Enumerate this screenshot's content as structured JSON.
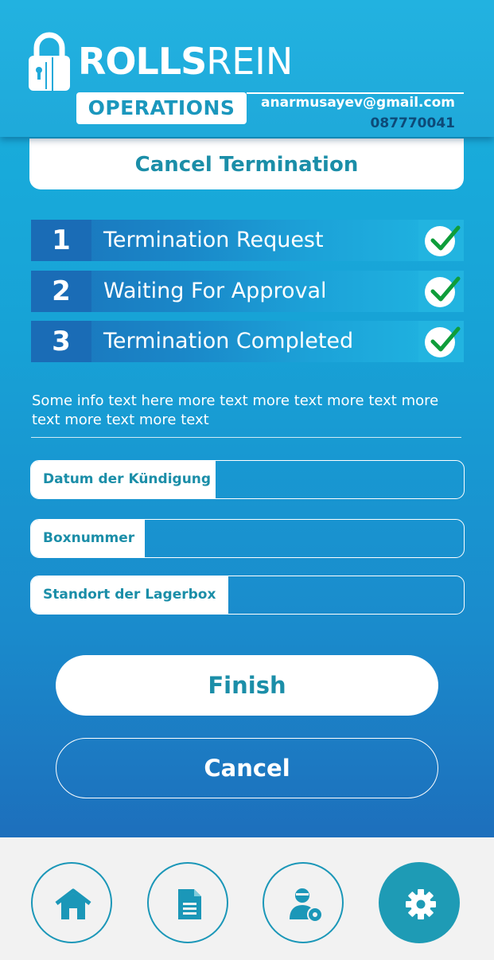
{
  "header": {
    "brand_bold": "ROLLS",
    "brand_light": "REIN",
    "subtitle": "OPERATIONS",
    "email": "anarmusayev@gmail.com",
    "phone": "087770041"
  },
  "page_title": "Cancel Termination",
  "steps": [
    {
      "number": "1",
      "label": "Termination Request",
      "completed": true
    },
    {
      "number": "2",
      "label": "Waiting For Approval",
      "completed": true
    },
    {
      "number": "3",
      "label": "Termination Completed",
      "completed": true
    }
  ],
  "info_text": "Some info text here more text more text more text more text more text more text",
  "fields": [
    {
      "label": "Datum der Kündigung",
      "value": ""
    },
    {
      "label": "Boxnummer",
      "value": ""
    },
    {
      "label": "Standort der Lagerbox",
      "value": ""
    }
  ],
  "buttons": {
    "finish": "Finish",
    "cancel": "Cancel"
  },
  "nav": {
    "items": [
      {
        "icon": "home-icon",
        "active": false
      },
      {
        "icon": "document-icon",
        "active": false
      },
      {
        "icon": "user-settings-icon",
        "active": false
      },
      {
        "icon": "gear-icon",
        "active": true
      }
    ]
  },
  "colors": {
    "accent": "#1b8ea8",
    "background_top": "#1ab2de",
    "background_bottom": "#1d6fbc",
    "check_green": "#0f9d3a"
  }
}
